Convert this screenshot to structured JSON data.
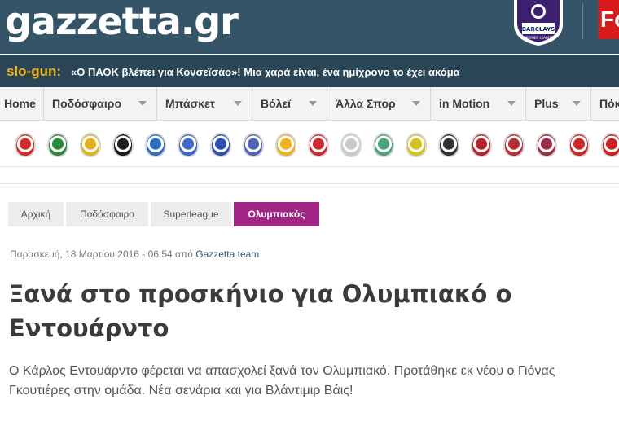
{
  "header": {
    "logo": "gazzetta.gr",
    "pl_badge_text": "BARCLAYS",
    "pl_badge_sub": "PREMIER LEAGUE",
    "fo_text": "Fo"
  },
  "ticker": {
    "label": "slo-gun:",
    "text": "«Ο ΠΑΟΚ βλέπει για Κονσεϊσάο»! Μια χαρά είναι, ένα ημίχρονο το έχει ακόμα"
  },
  "nav": {
    "items": [
      {
        "label": "Home"
      },
      {
        "label": "Ποδόσφαιρο"
      },
      {
        "label": "Μπάσκετ"
      },
      {
        "label": "Βόλεϊ"
      },
      {
        "label": "Άλλα Σπορ"
      },
      {
        "label": "in Motion"
      },
      {
        "label": "Plus"
      },
      {
        "label": "Πόκ"
      }
    ]
  },
  "teams": {
    "colors": [
      "#d62b2b",
      "#2a8a3c",
      "#e3b11c",
      "#1e1e1e",
      "#2f6fc2",
      "#3d67c8",
      "#2d4fb4",
      "#5064b5",
      "#f0b21a",
      "#cf2a32",
      "#c9c9c9",
      "#4aa37a",
      "#d5c21d",
      "#333333",
      "#b9212b",
      "#b63136",
      "#9a2f47",
      "#cc2a2a",
      "#cf1f25"
    ],
    "icon_names": [
      "olympiacos-crest-icon",
      "panathinaikos-crest-icon",
      "aek-crest-icon",
      "paok-crest-icon",
      "pas-giannina-crest-icon",
      "asteras-crest-icon",
      "atromitos-crest-icon",
      "panionios-crest-icon",
      "aris-crest-icon",
      "platanias-crest-icon",
      "xanthi-crest-icon",
      "levadiakos-crest-icon",
      "panetolikos-crest-icon",
      "veria-crest-icon",
      "iraklis-crest-icon",
      "real-madrid-crest-icon",
      "barcelona-crest-icon",
      "atletico-crest-icon",
      "man-utd-crest-icon"
    ]
  },
  "breadcrumb": {
    "items": [
      "Αρχική",
      "Ποδόσφαιρο",
      "Superleague",
      "Ολυμπιακός"
    ]
  },
  "article": {
    "date": "Παρασκευή, 18 Μαρτίου 2016 - 06:54",
    "by": "από",
    "author": "Gazzetta team",
    "title": "Ξανά στο προσκήνιο για Ολυμπιακό ο Εντουάρντο",
    "lead": "Ο Κάρλος Εντουάρντο φέρεται να απασχολεί ξανά τον Ολυμπιακό. Προτάθηκε εκ νέου ο Γιόνας Γκουτιέρες στην ομάδα. Νέα σενάρια και για Βλάντιμιρ Βάις!"
  }
}
